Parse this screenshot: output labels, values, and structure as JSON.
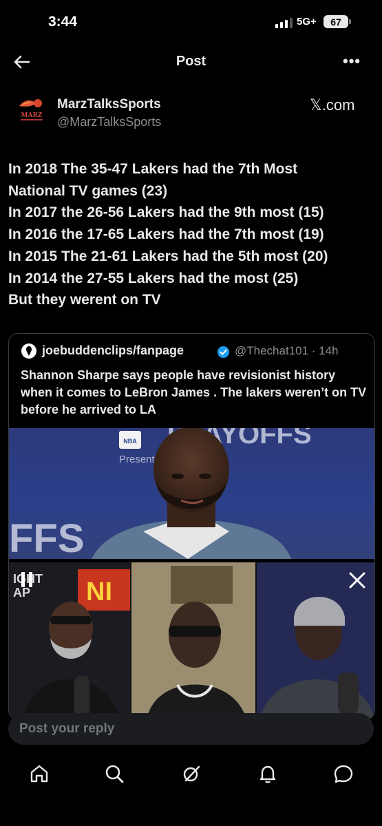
{
  "status_bar": {
    "time": "3:44",
    "network": "5G+",
    "battery": "67"
  },
  "header": {
    "title": "Post"
  },
  "post": {
    "author_name": "MarzTalksSports",
    "author_handle": "@MarzTalksSports",
    "avatar_text": "MARZ",
    "source": "𝕏.com",
    "lines": [
      "In 2018 The 35-47 Lakers had the 7th Most",
      "National TV games (23)",
      "In 2017 the 26-56 Lakers had the 9th most (15)",
      "In 2016 the 17-65 Lakers had the 7th most  (19)",
      "In 2015 The 21-61 Lakers had the 5th most  (20)",
      "In 2014 the 27-55 Lakers had the most (25)",
      "But they werent on TV"
    ]
  },
  "quote": {
    "name": "joebuddenclips/fanpage",
    "handle": "@Thechat101 · 14h",
    "text": "Shannon Sharpe says people have revisionist history when it comes to LeBron James . The lakers weren’t on TV before he arrived to LA",
    "media": {
      "top_sign": "PLAYOFFS",
      "nba_logo": "NBA",
      "sign_text": "Present"
    }
  },
  "reply": {
    "placeholder": "Post your reply"
  },
  "nav": [
    "home-icon",
    "search-icon",
    "grok-icon",
    "notifications-icon",
    "messages-icon"
  ]
}
